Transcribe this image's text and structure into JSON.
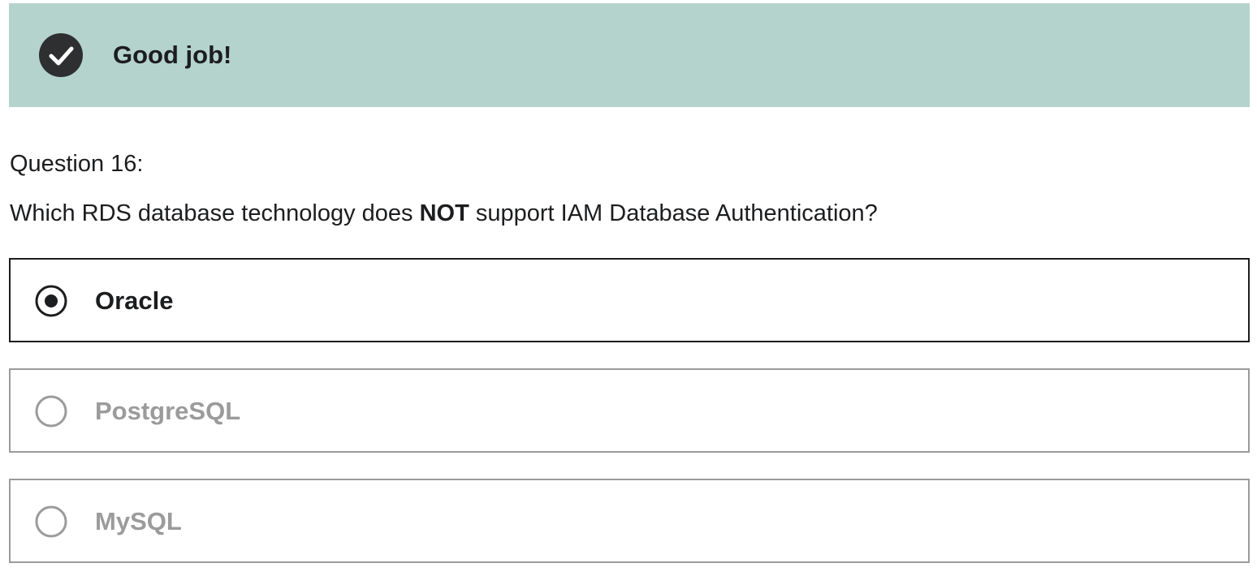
{
  "banner": {
    "icon": "check-circle-icon",
    "message": "Good job!",
    "background_color": "#b5d3cd"
  },
  "question": {
    "header": "Question 16:",
    "prompt_before": "Which RDS database technology does ",
    "prompt_emphasis": "NOT",
    "prompt_after": " support IAM Database Authentication?"
  },
  "answers": [
    {
      "label": "Oracle",
      "selected": true
    },
    {
      "label": "PostgreSQL",
      "selected": false
    },
    {
      "label": "MySQL",
      "selected": false
    }
  ],
  "colors": {
    "text": "#1c1d1f",
    "muted": "#9b9b9b"
  }
}
